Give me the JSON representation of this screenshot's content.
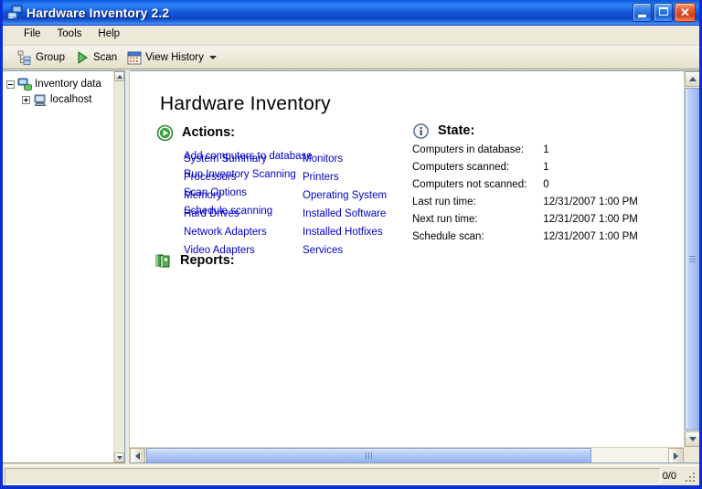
{
  "window": {
    "title": "Hardware Inventory 2.2",
    "icon": "computers-network-icon",
    "controls": {
      "minimize": "minimize-button",
      "maximize": "maximize-button",
      "close_glyph": "✕"
    }
  },
  "menubar": {
    "items": [
      {
        "label": "File"
      },
      {
        "label": "Tools"
      },
      {
        "label": "Help"
      }
    ]
  },
  "toolbar": {
    "buttons": [
      {
        "label": "Group",
        "icon": "group-tree-icon"
      },
      {
        "label": "Scan",
        "icon": "green-play-icon"
      },
      {
        "label": "View History",
        "icon": "calendar-icon",
        "has_dropdown": true
      }
    ]
  },
  "sidebar": {
    "tree": [
      {
        "label": "Inventory data",
        "expander": "minus",
        "icon": "inventory-database-icon",
        "level": 0
      },
      {
        "label": "localhost",
        "expander": "plus",
        "icon": "computer-icon",
        "level": 1
      }
    ]
  },
  "main": {
    "page_title": "Hardware Inventory",
    "actions": {
      "heading": "Actions:",
      "icon": "green-play-circle-icon",
      "links": [
        "Add computers to database",
        "Run Inventory Scanning",
        "Scan Options",
        "Schedule scanning"
      ]
    },
    "state": {
      "heading": "State:",
      "icon": "info-circle-icon",
      "rows": [
        {
          "label": "Computers in database:",
          "value": "1"
        },
        {
          "label": "Computers scanned:",
          "value": "1"
        },
        {
          "label": "Computers not scanned:",
          "value": "0"
        },
        {
          "label": "Last run time:",
          "value": "12/31/2007 1:00 PM"
        },
        {
          "label": "Next run time:",
          "value": "12/31/2007 1:00 PM"
        },
        {
          "label": "Schedule scan:",
          "value": "12/31/2007 1:00 PM"
        }
      ]
    },
    "reports": {
      "heading": "Reports:",
      "icon": "green-books-icon",
      "column_left": [
        "System Summary",
        "Processors",
        "Memory",
        "Hard Drives",
        "Network Adapters",
        "Video Adapters"
      ],
      "column_right": [
        "Monitors",
        "Printers",
        "Operating System",
        "Installed Software",
        "Installed Hotfixes",
        "Services"
      ]
    }
  },
  "statusbar": {
    "counter": "0/0"
  },
  "colors": {
    "titlebar_blue": "#1455d8",
    "window_border": "#0a2fd4",
    "chrome_beige": "#ece9d8",
    "link_blue": "#0000cc",
    "accent_green": "#1e8b1e",
    "close_red": "#d33d19"
  }
}
